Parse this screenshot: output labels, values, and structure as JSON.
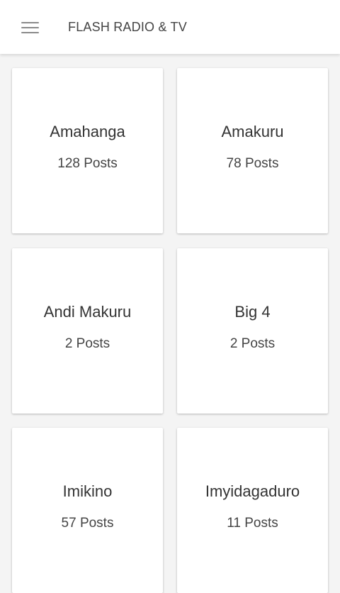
{
  "header": {
    "title": "FLASH RADIO & TV",
    "menu_icon": "hamburger-menu-icon"
  },
  "categories": [
    {
      "name": "Amahanga",
      "count": "128 Posts"
    },
    {
      "name": "Amakuru",
      "count": "78 Posts"
    },
    {
      "name": "Andi Makuru",
      "count": "2 Posts"
    },
    {
      "name": "Big 4",
      "count": "2 Posts"
    },
    {
      "name": "Imikino",
      "count": "57 Posts"
    },
    {
      "name": "Imyidagaduro",
      "count": "11 Posts"
    }
  ]
}
